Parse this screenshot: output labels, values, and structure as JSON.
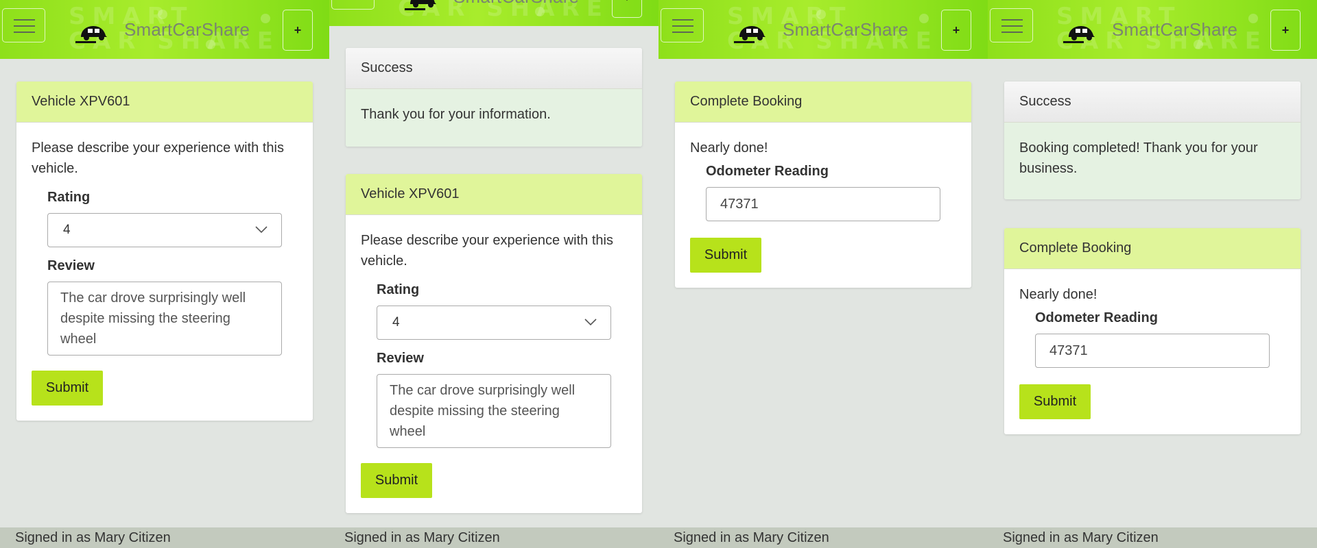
{
  "app": {
    "brand": "SmartCarShare",
    "watermark_top": "SMART",
    "watermark_bottom": "CAR SHARE",
    "menu_icon": "hamburger-icon",
    "plus_label": "+",
    "logo_icon": "car-icon"
  },
  "colors": {
    "appbar": "#9be624",
    "panel_heading": "#e0f59a",
    "success_body": "#e5f2e2",
    "button": "#b7e21b",
    "footer": "#c3cabe",
    "background": "#e1e5e1"
  },
  "footer_text": "Signed in as Mary Citizen",
  "review_form": {
    "heading": "Vehicle XPV601",
    "prompt": "Please describe your experience with this vehicle.",
    "rating_label": "Rating",
    "rating_value": "4",
    "review_label": "Review",
    "review_value": "The car drove surprisingly well despite missing the steering wheel",
    "submit_label": "Submit"
  },
  "success_info": {
    "heading": "Success",
    "message": "Thank you for your information."
  },
  "complete_booking": {
    "heading": "Complete Booking",
    "prompt": "Nearly done!",
    "odometer_label": "Odometer Reading",
    "odometer_value": "47371",
    "submit_label": "Submit"
  },
  "success_booking": {
    "heading": "Success",
    "message": "Booking completed! Thank you for your business."
  }
}
